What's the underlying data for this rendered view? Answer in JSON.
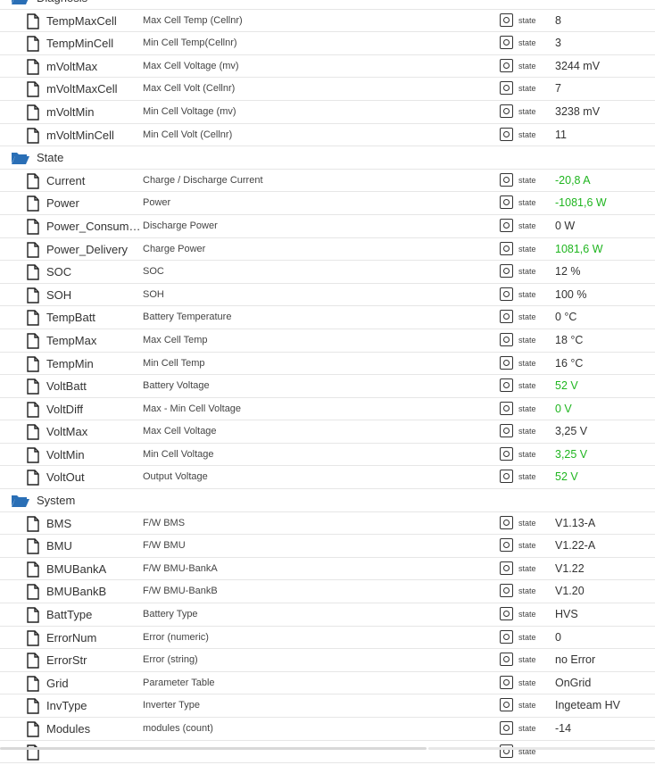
{
  "tree": [
    {
      "kind": "folder",
      "name": "Diagnosis"
    },
    {
      "kind": "item",
      "name": "TempMaxCell",
      "desc": "Max Cell Temp (Cellnr)",
      "type": "state",
      "value": "8",
      "green": false
    },
    {
      "kind": "item",
      "name": "TempMinCell",
      "desc": "Min Cell Temp(Cellnr)",
      "type": "state",
      "value": "3",
      "green": false
    },
    {
      "kind": "item",
      "name": "mVoltMax",
      "desc": "Max Cell Voltage (mv)",
      "type": "state",
      "value": "3244 mV",
      "green": false
    },
    {
      "kind": "item",
      "name": "mVoltMaxCell",
      "desc": "Max Cell Volt (Cellnr)",
      "type": "state",
      "value": "7",
      "green": false
    },
    {
      "kind": "item",
      "name": "mVoltMin",
      "desc": "Min Cell Voltage (mv)",
      "type": "state",
      "value": "3238 mV",
      "green": false
    },
    {
      "kind": "item",
      "name": "mVoltMinCell",
      "desc": "Min Cell Volt (Cellnr)",
      "type": "state",
      "value": "11",
      "green": false
    },
    {
      "kind": "folder",
      "name": "State"
    },
    {
      "kind": "item",
      "name": "Current",
      "desc": "Charge / Discharge Current",
      "type": "state",
      "value": "-20,8 A",
      "green": true
    },
    {
      "kind": "item",
      "name": "Power",
      "desc": "Power",
      "type": "state",
      "value": "-1081,6 W",
      "green": true
    },
    {
      "kind": "item",
      "name": "Power_Consump...",
      "desc": "Discharge Power",
      "type": "state",
      "value": "0 W",
      "green": false
    },
    {
      "kind": "item",
      "name": "Power_Delivery",
      "desc": "Charge Power",
      "type": "state",
      "value": "1081,6 W",
      "green": true
    },
    {
      "kind": "item",
      "name": "SOC",
      "desc": "SOC",
      "type": "state",
      "value": "12 %",
      "green": false
    },
    {
      "kind": "item",
      "name": "SOH",
      "desc": "SOH",
      "type": "state",
      "value": "100 %",
      "green": false
    },
    {
      "kind": "item",
      "name": "TempBatt",
      "desc": "Battery Temperature",
      "type": "state",
      "value": "0 °C",
      "green": false
    },
    {
      "kind": "item",
      "name": "TempMax",
      "desc": "Max Cell Temp",
      "type": "state",
      "value": "18 °C",
      "green": false
    },
    {
      "kind": "item",
      "name": "TempMin",
      "desc": "Min Cell Temp",
      "type": "state",
      "value": "16 °C",
      "green": false
    },
    {
      "kind": "item",
      "name": "VoltBatt",
      "desc": "Battery Voltage",
      "type": "state",
      "value": "52 V",
      "green": true
    },
    {
      "kind": "item",
      "name": "VoltDiff",
      "desc": "Max - Min Cell Voltage",
      "type": "state",
      "value": "0 V",
      "green": true
    },
    {
      "kind": "item",
      "name": "VoltMax",
      "desc": "Max Cell Voltage",
      "type": "state",
      "value": "3,25 V",
      "green": false
    },
    {
      "kind": "item",
      "name": "VoltMin",
      "desc": "Min Cell Voltage",
      "type": "state",
      "value": "3,25 V",
      "green": true
    },
    {
      "kind": "item",
      "name": "VoltOut",
      "desc": "Output Voltage",
      "type": "state",
      "value": "52 V",
      "green": true
    },
    {
      "kind": "folder",
      "name": "System"
    },
    {
      "kind": "item",
      "name": "BMS",
      "desc": "F/W BMS",
      "type": "state",
      "value": "V1.13-A",
      "green": false
    },
    {
      "kind": "item",
      "name": "BMU",
      "desc": "F/W BMU",
      "type": "state",
      "value": "V1.22-A",
      "green": false
    },
    {
      "kind": "item",
      "name": "BMUBankA",
      "desc": "F/W BMU-BankA",
      "type": "state",
      "value": "V1.22",
      "green": false
    },
    {
      "kind": "item",
      "name": "BMUBankB",
      "desc": "F/W BMU-BankB",
      "type": "state",
      "value": "V1.20",
      "green": false
    },
    {
      "kind": "item",
      "name": "BattType",
      "desc": "Battery Type",
      "type": "state",
      "value": "HVS",
      "green": false
    },
    {
      "kind": "item",
      "name": "ErrorNum",
      "desc": "Error (numeric)",
      "type": "state",
      "value": "0",
      "green": false
    },
    {
      "kind": "item",
      "name": "ErrorStr",
      "desc": "Error (string)",
      "type": "state",
      "value": "no Error",
      "green": false
    },
    {
      "kind": "item",
      "name": "Grid",
      "desc": "Parameter Table",
      "type": "state",
      "value": "OnGrid",
      "green": false
    },
    {
      "kind": "item",
      "name": "InvType",
      "desc": "Inverter Type",
      "type": "state",
      "value": "Ingeteam HV",
      "green": false
    },
    {
      "kind": "item",
      "name": "Modules",
      "desc": "modules (count)",
      "type": "state",
      "value": "-14",
      "green": false
    },
    {
      "kind": "item",
      "name": "",
      "desc": "",
      "type": "state",
      "value": "",
      "green": false
    }
  ],
  "icons": {
    "folder": "folder-open-icon",
    "item": "document-icon",
    "state_button": "state-button-icon"
  },
  "colors": {
    "green_value": "#1fb51f",
    "folder_icon": "#2a6fb6"
  }
}
